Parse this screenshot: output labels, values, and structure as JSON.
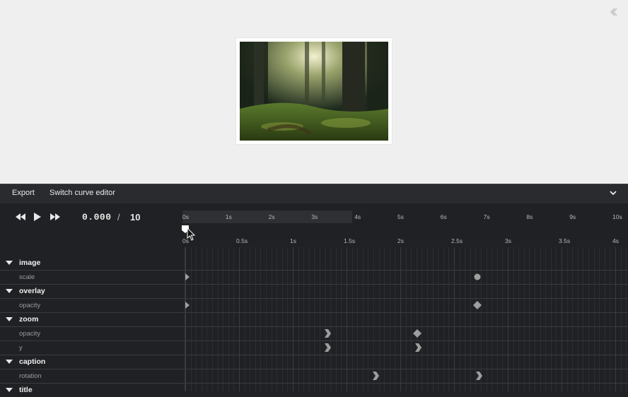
{
  "toolbar": {
    "export_label": "Export",
    "switch_label": "Switch curve editor"
  },
  "transport": {
    "current_time": "0.000",
    "separator": "/",
    "total": "10"
  },
  "ruler_top": [
    "0s",
    "1s",
    "2s",
    "3s",
    "4s",
    "5s",
    "6s",
    "7s",
    "8s",
    "9s",
    "10s"
  ],
  "ruler_bottom": [
    "0s",
    "0.5s",
    "1s",
    "1.5s",
    "2s",
    "2.5s",
    "3s",
    "3.5s",
    "4s"
  ],
  "tracks": [
    {
      "type": "group",
      "label": "image"
    },
    {
      "type": "prop",
      "label": "scale"
    },
    {
      "type": "group",
      "label": "overlay"
    },
    {
      "type": "prop",
      "label": "opacity"
    },
    {
      "type": "group",
      "label": "zoom"
    },
    {
      "type": "prop",
      "label": "opacity"
    },
    {
      "type": "prop",
      "label": "y"
    },
    {
      "type": "group",
      "label": "caption"
    },
    {
      "type": "prop",
      "label": "rotation"
    },
    {
      "type": "group",
      "label": "title"
    }
  ],
  "colors": {
    "accent": "#ffffff",
    "keyframe": "#9e9e9e",
    "panel_bg": "#202124"
  },
  "icons": [
    "collapse-left-icon",
    "chevron-down-icon",
    "rewind-icon",
    "play-icon",
    "fast-forward-icon",
    "playhead-icon",
    "cursor-icon"
  ]
}
